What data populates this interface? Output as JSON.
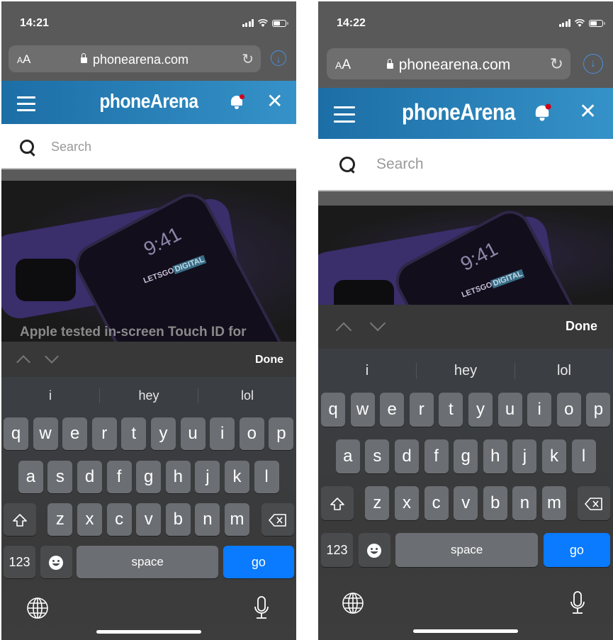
{
  "screens": [
    {
      "status": {
        "time": "14:21"
      },
      "browser": {
        "text_size": "AA",
        "url": "phonearena.com"
      },
      "site": {
        "logo": "phoneArena",
        "search_placeholder": "Search"
      },
      "article": {
        "headline": "Apple tested in-screen Touch ID for",
        "image_text": {
          "clock": "9:41",
          "brand": "LETSGO",
          "brand2": "DIGITAL"
        }
      },
      "toolbar": {
        "done": "Done"
      },
      "suggestions": [
        "i",
        "hey",
        "lol"
      ]
    },
    {
      "status": {
        "time": "14:22"
      },
      "browser": {
        "text_size": "AA",
        "url": "phonearena.com"
      },
      "site": {
        "logo": "phoneArena",
        "search_placeholder": "Search"
      },
      "article": {
        "image_text": {
          "clock": "9:41",
          "brand": "LETSGO",
          "brand2": "DIGITAL"
        }
      },
      "toolbar": {
        "done": "Done"
      },
      "suggestions": [
        "i",
        "hey",
        "lol"
      ]
    }
  ],
  "keyboard": {
    "row1": [
      "q",
      "w",
      "e",
      "r",
      "t",
      "y",
      "u",
      "i",
      "o",
      "p"
    ],
    "row2": [
      "a",
      "s",
      "d",
      "f",
      "g",
      "h",
      "j",
      "k",
      "l"
    ],
    "row3": [
      "z",
      "x",
      "c",
      "v",
      "b",
      "n",
      "m"
    ],
    "numbers": "123",
    "space": "space",
    "go": "go"
  },
  "colors": {
    "accent": "#0a7aff",
    "header_start": "#1c6ea6",
    "header_end": "#3592c8",
    "notification": "#d0021b"
  }
}
